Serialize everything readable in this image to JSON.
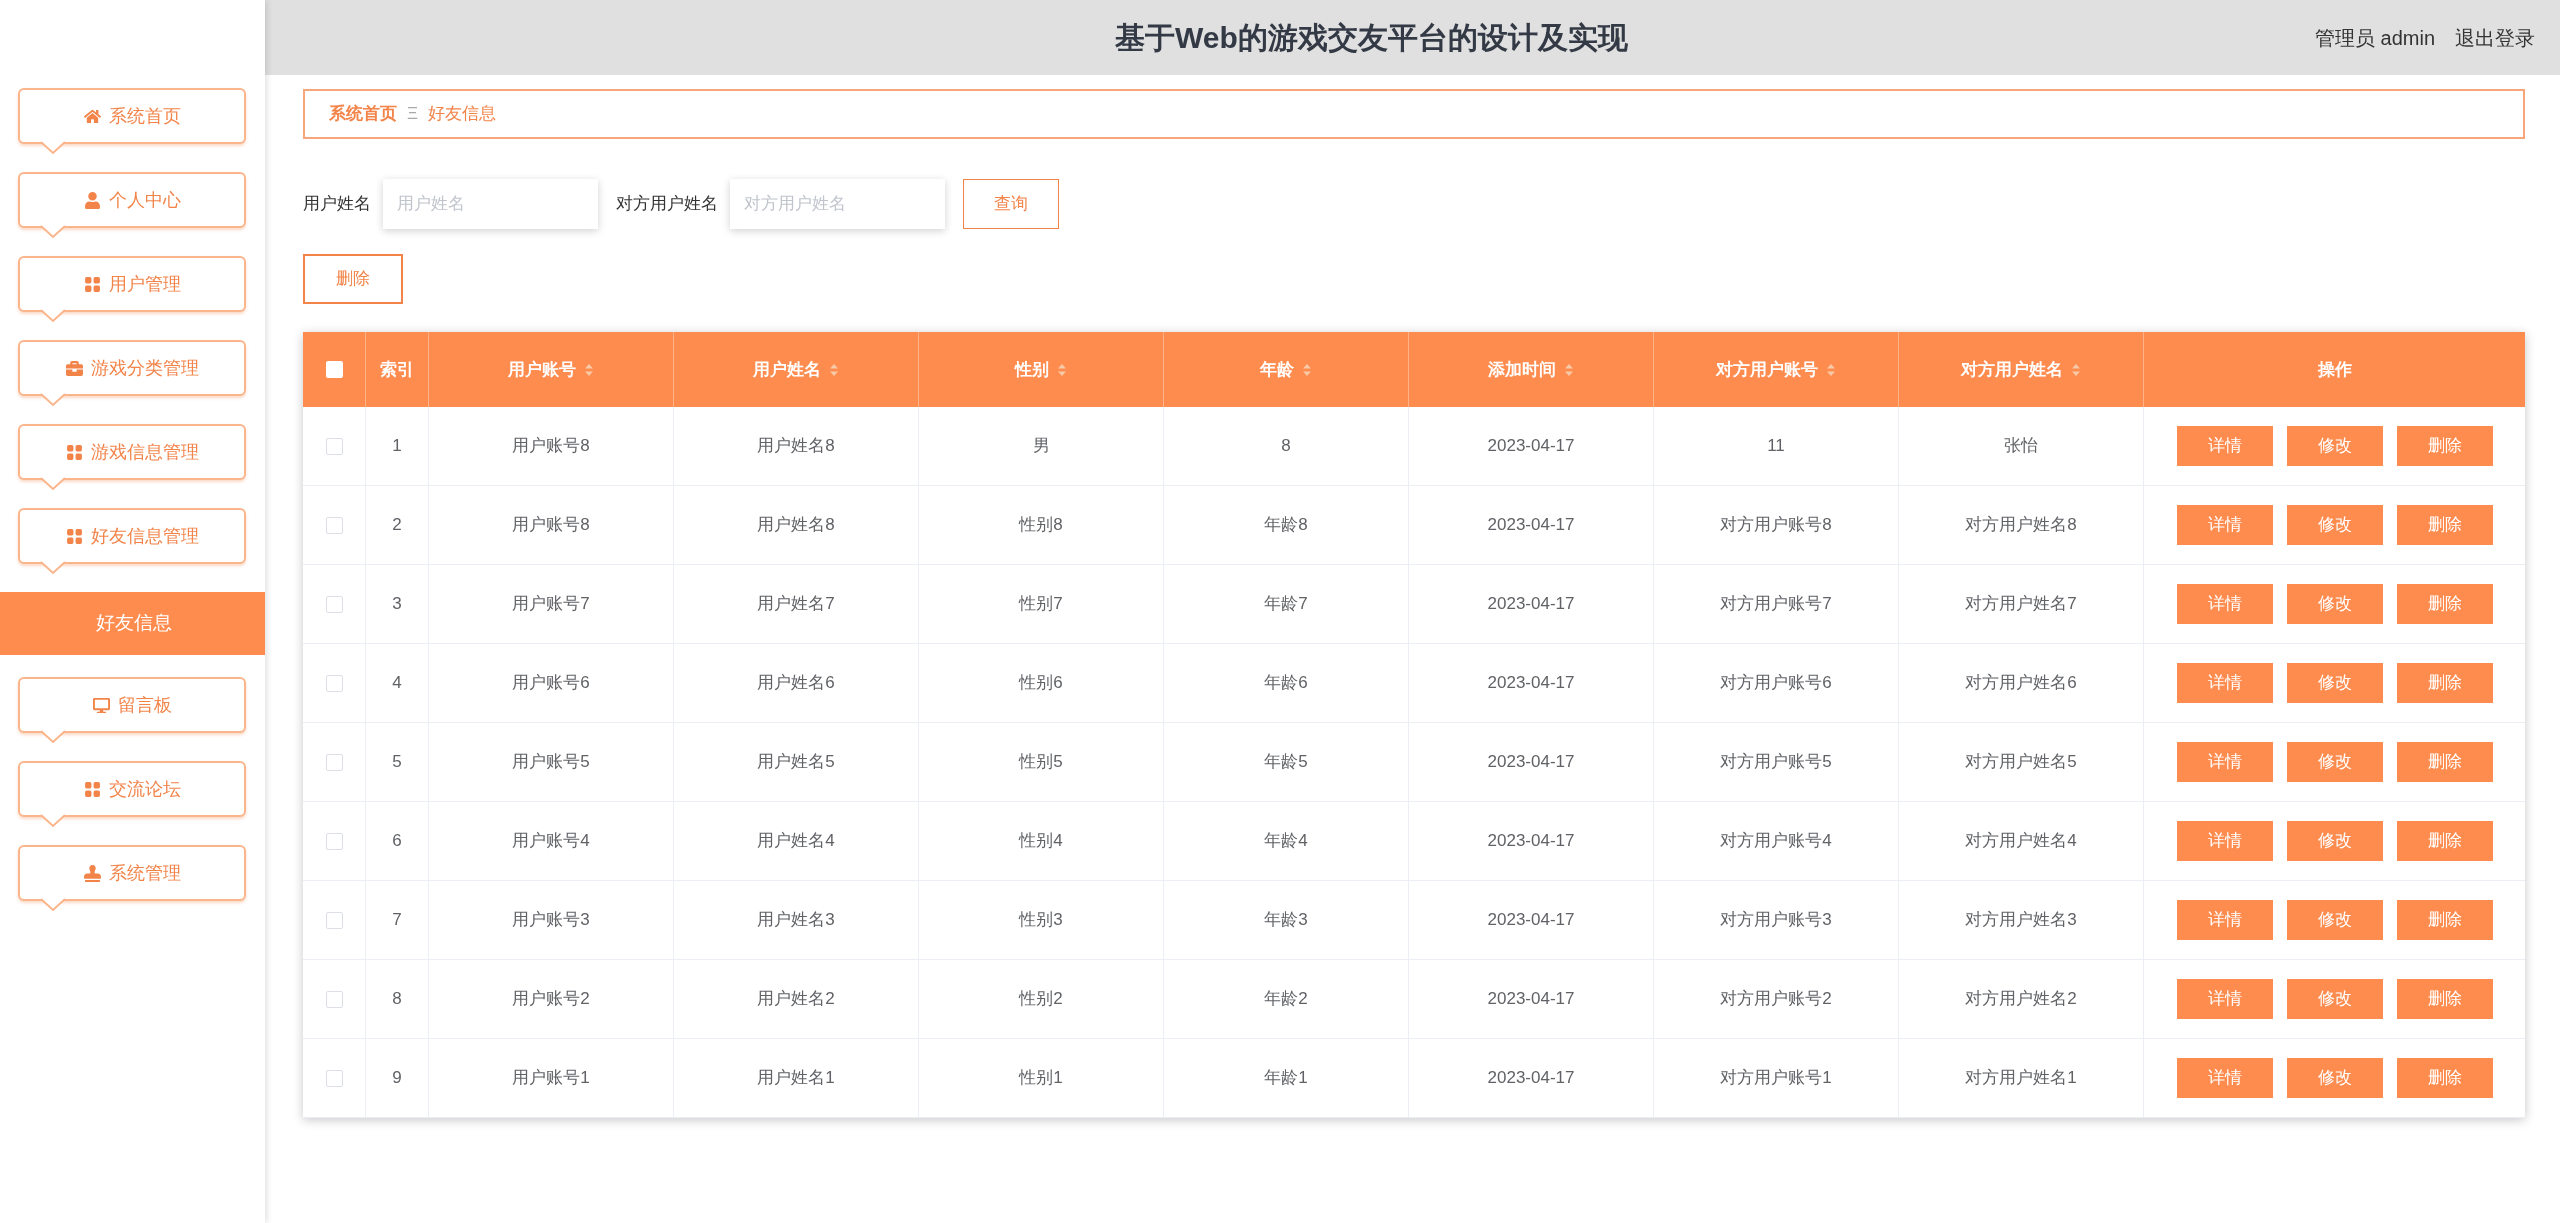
{
  "header": {
    "title": "基于Web的游戏交友平台的设计及实现",
    "user": "管理员 admin",
    "logout": "退出登录"
  },
  "sidebar": {
    "items": [
      {
        "label": "系统首页",
        "selected": false
      },
      {
        "label": "个人中心",
        "selected": false
      },
      {
        "label": "用户管理",
        "selected": false
      },
      {
        "label": "游戏分类管理",
        "selected": false
      },
      {
        "label": "游戏信息管理",
        "selected": false
      },
      {
        "label": "好友信息管理",
        "selected": false,
        "children": [
          {
            "label": "好友信息",
            "selected": true
          }
        ]
      },
      {
        "label": "留言板",
        "selected": false
      },
      {
        "label": "交流论坛",
        "selected": false
      },
      {
        "label": "系统管理",
        "selected": false
      }
    ]
  },
  "breadcrumb": {
    "home": "系统首页",
    "separator": "Ξ",
    "current": "好友信息"
  },
  "search": {
    "fields": [
      {
        "label": "用户姓名",
        "placeholder": "用户姓名"
      },
      {
        "label": "对方用户姓名",
        "placeholder": "对方用户姓名"
      }
    ],
    "button": "查询"
  },
  "delete_button": "删除",
  "table": {
    "select_all_checked": false,
    "columns": [
      {
        "label": "索引",
        "sortable": false
      },
      {
        "label": "用户账号",
        "sortable": true
      },
      {
        "label": "用户姓名",
        "sortable": true
      },
      {
        "label": "性别",
        "sortable": true
      },
      {
        "label": "年龄",
        "sortable": true
      },
      {
        "label": "添加时间",
        "sortable": true
      },
      {
        "label": "对方用户账号",
        "sortable": true
      },
      {
        "label": "对方用户姓名",
        "sortable": true
      },
      {
        "label": "操作",
        "sortable": false
      }
    ],
    "rows": [
      {
        "checked": false,
        "cells": [
          "1",
          "用户账号8",
          "用户姓名8",
          "男",
          "8",
          "2023-04-17",
          "11",
          "张怡"
        ],
        "actions": [
          "详情",
          "修改",
          "删除"
        ]
      },
      {
        "checked": false,
        "cells": [
          "2",
          "用户账号8",
          "用户姓名8",
          "性别8",
          "年龄8",
          "2023-04-17",
          "对方用户账号8",
          "对方用户姓名8"
        ],
        "actions": [
          "详情",
          "修改",
          "删除"
        ]
      },
      {
        "checked": false,
        "cells": [
          "3",
          "用户账号7",
          "用户姓名7",
          "性别7",
          "年龄7",
          "2023-04-17",
          "对方用户账号7",
          "对方用户姓名7"
        ],
        "actions": [
          "详情",
          "修改",
          "删除"
        ]
      },
      {
        "checked": false,
        "cells": [
          "4",
          "用户账号6",
          "用户姓名6",
          "性别6",
          "年龄6",
          "2023-04-17",
          "对方用户账号6",
          "对方用户姓名6"
        ],
        "actions": [
          "详情",
          "修改",
          "删除"
        ]
      },
      {
        "checked": false,
        "cells": [
          "5",
          "用户账号5",
          "用户姓名5",
          "性别5",
          "年龄5",
          "2023-04-17",
          "对方用户账号5",
          "对方用户姓名5"
        ],
        "actions": [
          "详情",
          "修改",
          "删除"
        ]
      },
      {
        "checked": false,
        "cells": [
          "6",
          "用户账号4",
          "用户姓名4",
          "性别4",
          "年龄4",
          "2023-04-17",
          "对方用户账号4",
          "对方用户姓名4"
        ],
        "actions": [
          "详情",
          "修改",
          "删除"
        ]
      },
      {
        "checked": false,
        "cells": [
          "7",
          "用户账号3",
          "用户姓名3",
          "性别3",
          "年龄3",
          "2023-04-17",
          "对方用户账号3",
          "对方用户姓名3"
        ],
        "actions": [
          "详情",
          "修改",
          "删除"
        ]
      },
      {
        "checked": false,
        "cells": [
          "8",
          "用户账号2",
          "用户姓名2",
          "性别2",
          "年龄2",
          "2023-04-17",
          "对方用户账号2",
          "对方用户姓名2"
        ],
        "actions": [
          "详情",
          "修改",
          "删除"
        ]
      },
      {
        "checked": false,
        "cells": [
          "9",
          "用户账号1",
          "用户姓名1",
          "性别1",
          "年龄1",
          "2023-04-17",
          "对方用户账号1",
          "对方用户姓名1"
        ],
        "actions": [
          "详情",
          "修改",
          "删除"
        ]
      }
    ]
  }
}
